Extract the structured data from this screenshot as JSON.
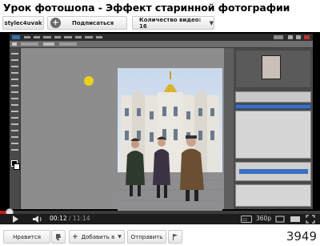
{
  "video": {
    "title": "Урок фотошопа - Эффект старинной фотографии",
    "current_time": "00:12",
    "duration": "/ 11:14",
    "quality": "360p",
    "progress_fraction": 0.018
  },
  "channel": {
    "name": "stylec4uvak",
    "subscribe_label": "Подписаться",
    "views_label": "Количество видео: 16"
  },
  "actions": {
    "like_label": "Нравится",
    "add_label": "Добавить в",
    "share_label": "Отправить",
    "view_count": "3949"
  },
  "colors": {
    "progress": "#cc181e",
    "cursor_highlight": "#e8d21a"
  }
}
